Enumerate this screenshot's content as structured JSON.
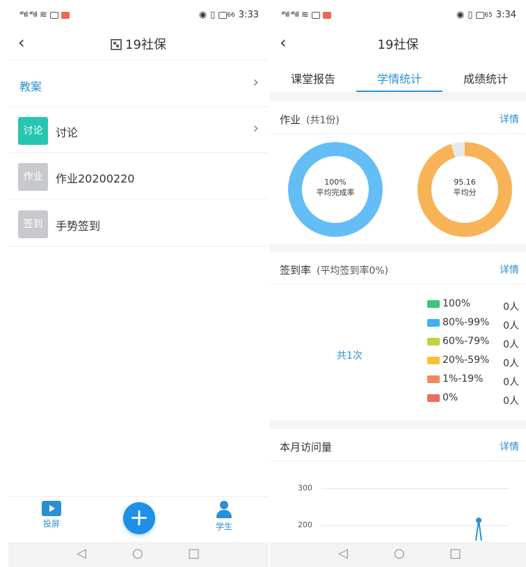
{
  "left": {
    "status": {
      "time": "3:33",
      "battery": "66"
    },
    "nav": {
      "title": "19社保"
    },
    "rows": [
      {
        "label": "教案"
      },
      {
        "badge": "讨论",
        "label": "讨论",
        "color": "#26c6b0"
      },
      {
        "badge": "作业",
        "label": "作业20200220",
        "color": "#c7c9cc"
      },
      {
        "badge": "签到",
        "label": "手势签到",
        "color": "#c7c9cc"
      }
    ],
    "bottom": {
      "cast": "投屏",
      "students": "学生",
      "plus": "+"
    }
  },
  "right": {
    "status": {
      "time": "3:34",
      "battery": "65"
    },
    "nav": {
      "title": "19社保"
    },
    "tabs": [
      {
        "label": "课堂报告"
      },
      {
        "label": "学情统计"
      },
      {
        "label": "成绩统计"
      }
    ],
    "homework": {
      "title": "作业",
      "subtitle": "(共1份)",
      "detail": "详情",
      "completion": {
        "value": "100%",
        "caption": "平均完成率",
        "fraction": 1.0,
        "color": "#64bdf5"
      },
      "score": {
        "value": "95.16",
        "caption": "平均分",
        "fraction": 0.9516,
        "color": "#f7b356"
      }
    },
    "signin": {
      "title": "签到率",
      "subtitle": "(平均签到率0%)",
      "detail": "详情",
      "total": "共1次",
      "legend": [
        {
          "label": "100%",
          "count": "0人",
          "color": "#3ec47c"
        },
        {
          "label": "80%-99%",
          "count": "0人",
          "color": "#3fb0f0"
        },
        {
          "label": "60%-79%",
          "count": "0人",
          "color": "#c4cf3c"
        },
        {
          "label": "20%-59%",
          "count": "0人",
          "color": "#f5c23a"
        },
        {
          "label": "1%-19%",
          "count": "0人",
          "color": "#f08a5a"
        },
        {
          "label": "0%",
          "count": "0人",
          "color": "#ee6a62"
        }
      ]
    },
    "visits": {
      "title": "本月访问量",
      "detail": "详情",
      "ticks": [
        "300",
        "200"
      ]
    }
  },
  "sysnav": {
    "back": "◁",
    "home": "○",
    "recent": "□"
  }
}
